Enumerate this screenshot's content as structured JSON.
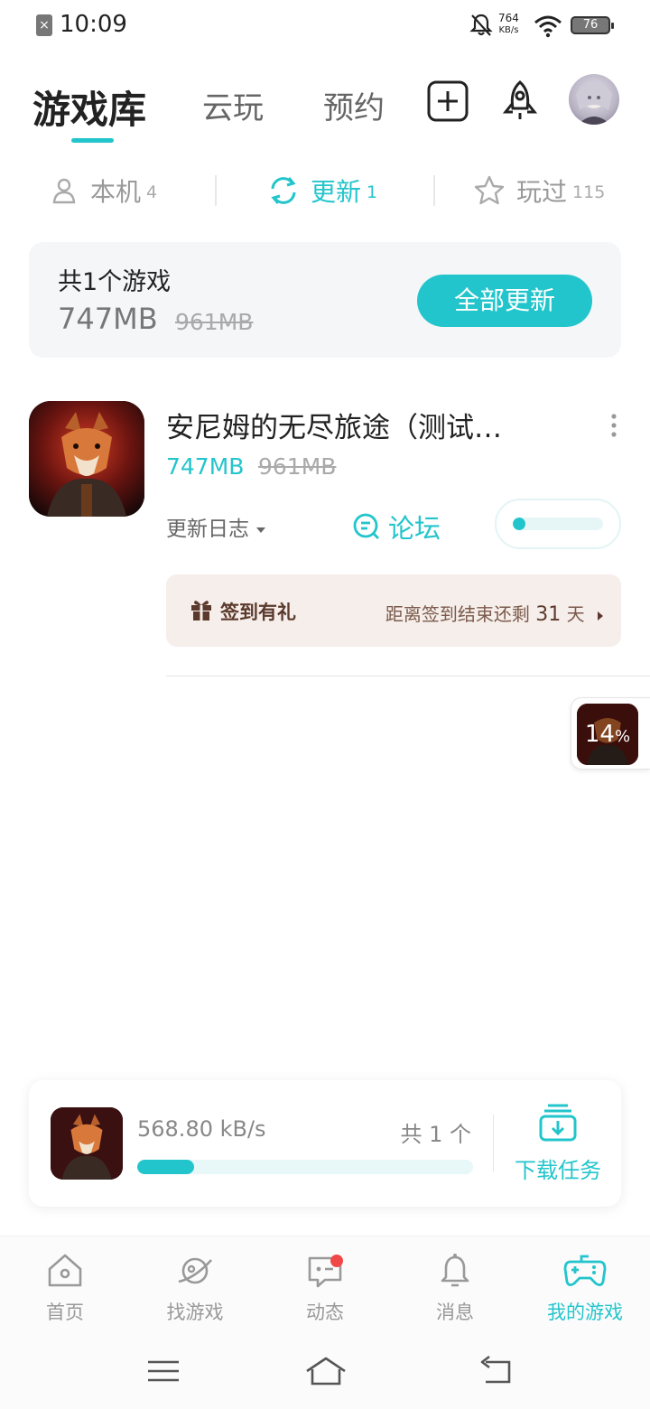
{
  "status_bar": {
    "time": "10:09",
    "net_speed_value": "764",
    "net_speed_unit": "KB/s",
    "battery": "76"
  },
  "header": {
    "tabs": [
      "游戏库",
      "云玩",
      "预约"
    ],
    "active_tab": "游戏库"
  },
  "sub_tabs": {
    "local": {
      "label": "本机",
      "count": "4"
    },
    "update": {
      "label": "更新",
      "count": "1"
    },
    "played": {
      "label": "玩过",
      "count": "115"
    }
  },
  "summary": {
    "title": "共1个游戏",
    "size": "747MB",
    "old_size": "961MB",
    "button": "全部更新"
  },
  "game": {
    "name": "安尼姆的无尽旅途（测试…",
    "size": "747MB",
    "old_size": "961MB",
    "changelog": "更新日志",
    "forum": "论坛",
    "progress": 0.14
  },
  "checkin": {
    "title": "签到有礼",
    "remain_prefix": "距离签到结束还剩",
    "remain_days": "31",
    "remain_suffix": "天"
  },
  "floating": {
    "percent_value": "14",
    "percent_sign": "%"
  },
  "download": {
    "speed": "568.80 kB/s",
    "total": "共 1 个",
    "progress": 0.17,
    "task_label": "下载任务"
  },
  "bottom_nav": {
    "items": [
      {
        "label": "首页",
        "icon": "home-icon"
      },
      {
        "label": "找游戏",
        "icon": "planet-icon"
      },
      {
        "label": "动态",
        "icon": "chat-icon"
      },
      {
        "label": "消息",
        "icon": "bell-icon"
      },
      {
        "label": "我的游戏",
        "icon": "gamepad-icon"
      }
    ],
    "active": "我的游戏"
  },
  "colors": {
    "accent": "#23c5cc",
    "checkin_bg": "#f6eeea",
    "badge_red": "#f04848"
  }
}
